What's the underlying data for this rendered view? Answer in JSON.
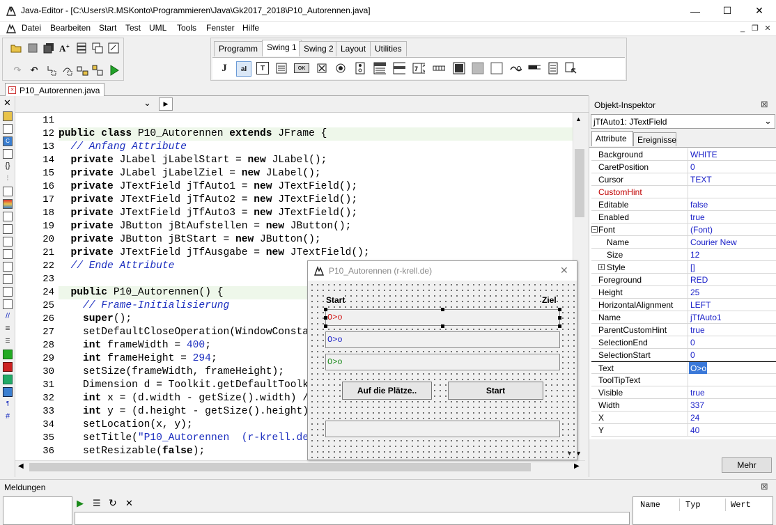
{
  "window": {
    "title": "Java-Editor - [C:\\Users\\R.MSKonto\\Programmieren\\Java\\Gk2017_2018\\P10_Autorennen.java]",
    "minimize_glyph": "—",
    "maximize_glyph": "☐",
    "close_glyph": "✕"
  },
  "menu": {
    "items": [
      "Datei",
      "Bearbeiten",
      "Start",
      "Test",
      "UML",
      "Tools",
      "Fenster",
      "Hilfe"
    ],
    "mdi_min": "_",
    "mdi_restore": "❐",
    "mdi_close": "✕"
  },
  "palette_tabs": [
    "Programm",
    "Swing 1",
    "Swing 2",
    "Layout",
    "Utilities"
  ],
  "palette_active": "Swing 1",
  "swing_icons": {
    "j": "J",
    "label_a": "aI",
    "label_t": "T",
    "ok": "OK"
  },
  "editor": {
    "tab_label": "P10_Autorennen.java",
    "close_glyph": "✕",
    "dropdown_glyph": "⌄",
    "play_glyph": "▶",
    "lines": [
      {
        "n": "11",
        "segs": []
      },
      {
        "n": "12",
        "segs": [
          [
            "kw",
            "public class "
          ],
          [
            "n",
            "P10_Autorennen "
          ],
          [
            "kw",
            "extends "
          ],
          [
            "n",
            "JFrame {"
          ]
        ]
      },
      {
        "n": "13",
        "segs": [
          [
            "n",
            "  "
          ],
          [
            "cm",
            "// Anfang Attribute"
          ]
        ]
      },
      {
        "n": "14",
        "segs": [
          [
            "n",
            "  "
          ],
          [
            "kw",
            "private "
          ],
          [
            "n",
            "JLabel jLabelStart = "
          ],
          [
            "kw",
            "new "
          ],
          [
            "n",
            "JLabel();"
          ]
        ]
      },
      {
        "n": "15",
        "segs": [
          [
            "n",
            "  "
          ],
          [
            "kw",
            "private "
          ],
          [
            "n",
            "JLabel jLabelZiel = "
          ],
          [
            "kw",
            "new "
          ],
          [
            "n",
            "JLabel();"
          ]
        ]
      },
      {
        "n": "16",
        "segs": [
          [
            "n",
            "  "
          ],
          [
            "kw",
            "private "
          ],
          [
            "n",
            "JTextField jTfAuto1 = "
          ],
          [
            "kw",
            "new "
          ],
          [
            "n",
            "JTextField();"
          ]
        ]
      },
      {
        "n": "17",
        "segs": [
          [
            "n",
            "  "
          ],
          [
            "kw",
            "private "
          ],
          [
            "n",
            "JTextField jTfAuto2 = "
          ],
          [
            "kw",
            "new "
          ],
          [
            "n",
            "JTextField();"
          ]
        ]
      },
      {
        "n": "18",
        "segs": [
          [
            "n",
            "  "
          ],
          [
            "kw",
            "private "
          ],
          [
            "n",
            "JTextField jTfAuto3 = "
          ],
          [
            "kw",
            "new "
          ],
          [
            "n",
            "JTextField();"
          ]
        ]
      },
      {
        "n": "19",
        "segs": [
          [
            "n",
            "  "
          ],
          [
            "kw",
            "private "
          ],
          [
            "n",
            "JButton jBtAufstellen = "
          ],
          [
            "kw",
            "new "
          ],
          [
            "n",
            "JButton();"
          ]
        ]
      },
      {
        "n": "20",
        "segs": [
          [
            "n",
            "  "
          ],
          [
            "kw",
            "private "
          ],
          [
            "n",
            "JButton jBtStart = "
          ],
          [
            "kw",
            "new "
          ],
          [
            "n",
            "JButton();"
          ]
        ]
      },
      {
        "n": "21",
        "segs": [
          [
            "n",
            "  "
          ],
          [
            "kw",
            "private "
          ],
          [
            "n",
            "JTextField jTfAusgabe = "
          ],
          [
            "kw",
            "new "
          ],
          [
            "n",
            "JTextField();"
          ]
        ]
      },
      {
        "n": "22",
        "segs": [
          [
            "n",
            "  "
          ],
          [
            "cm",
            "// Ende Attribute"
          ]
        ]
      },
      {
        "n": "23",
        "segs": []
      },
      {
        "n": "24",
        "segs": [
          [
            "n",
            "  "
          ],
          [
            "kw",
            "public "
          ],
          [
            "n",
            "P10_Autorennen() {"
          ]
        ]
      },
      {
        "n": "25",
        "segs": [
          [
            "n",
            "    "
          ],
          [
            "cm",
            "// Frame-Initialisierung"
          ]
        ]
      },
      {
        "n": "26",
        "segs": [
          [
            "n",
            "    "
          ],
          [
            "kw",
            "super"
          ],
          [
            "n",
            "();"
          ]
        ]
      },
      {
        "n": "27",
        "segs": [
          [
            "n",
            "    setDefaultCloseOperation(WindowConstants.DISPOSE_ON_CLOSE);"
          ]
        ]
      },
      {
        "n": "28",
        "segs": [
          [
            "n",
            "    "
          ],
          [
            "kw",
            "int "
          ],
          [
            "n",
            "frameWidth = "
          ],
          [
            "num",
            "400"
          ],
          [
            "n",
            ";"
          ]
        ]
      },
      {
        "n": "29",
        "segs": [
          [
            "n",
            "    "
          ],
          [
            "kw",
            "int "
          ],
          [
            "n",
            "frameHeight = "
          ],
          [
            "num",
            "294"
          ],
          [
            "n",
            ";"
          ]
        ]
      },
      {
        "n": "30",
        "segs": [
          [
            "n",
            "    setSize(frameWidth, frameHeight);"
          ]
        ]
      },
      {
        "n": "31",
        "segs": [
          [
            "n",
            "    Dimension d = Toolkit.getDefaultToolkit().getScreenSize();"
          ]
        ]
      },
      {
        "n": "32",
        "segs": [
          [
            "n",
            "    "
          ],
          [
            "kw",
            "int "
          ],
          [
            "n",
            "x = (d.width - getSize().width) / 2;"
          ]
        ]
      },
      {
        "n": "33",
        "segs": [
          [
            "n",
            "    "
          ],
          [
            "kw",
            "int "
          ],
          [
            "n",
            "y = (d.height - getSize().height) / 2;"
          ]
        ]
      },
      {
        "n": "34",
        "segs": [
          [
            "n",
            "    setLocation(x, y);"
          ]
        ]
      },
      {
        "n": "35",
        "segs": [
          [
            "n",
            "    setTitle("
          ],
          [
            "str",
            "\"P10_Autorennen  (r-krell.de)\""
          ],
          [
            "n",
            ");"
          ]
        ]
      },
      {
        "n": "36",
        "segs": [
          [
            "n",
            "    setResizable("
          ],
          [
            "kw",
            "false"
          ],
          [
            "n",
            ");"
          ]
        ]
      }
    ]
  },
  "designer": {
    "title": "P10_Autorennen  (r-krell.de)",
    "close_glyph": "✕",
    "label_start": "Start",
    "label_ziel": "Ziel",
    "auto1": "O>o",
    "auto2": "O>o",
    "auto3": "O>o",
    "auto1_color": "#d01010",
    "auto2_color": "#1a20c8",
    "auto3_color": "#1a8a1a",
    "btn_aufstellen": "Auf die Plätze..",
    "btn_start": "Start",
    "ausgabe": ""
  },
  "inspector": {
    "title": "Objekt-Inspektor",
    "close_glyph": "⊠",
    "selected": "jTfAuto1: JTextField",
    "tab_attribute": "Attribute",
    "tab_ereignisse": "Ereignisse",
    "more_button": "Mehr",
    "properties": [
      {
        "name": "Background",
        "value": "WHITE"
      },
      {
        "name": "CaretPosition",
        "value": "0"
      },
      {
        "name": "Cursor",
        "value": "TEXT"
      },
      {
        "name": "CustomHint",
        "value": ""
      },
      {
        "name": "Editable",
        "value": "false"
      },
      {
        "name": "Enabled",
        "value": "true"
      },
      {
        "name": "Font",
        "value": "(Font)"
      },
      {
        "name": "Name",
        "value": "Courier New"
      },
      {
        "name": "Size",
        "value": "12"
      },
      {
        "name": "Style",
        "value": "[]"
      },
      {
        "name": "Foreground",
        "value": "RED"
      },
      {
        "name": "Height",
        "value": "25"
      },
      {
        "name": "HorizontalAlignment",
        "value": "LEFT"
      },
      {
        "name": "Name",
        "value": "jTfAuto1"
      },
      {
        "name": "ParentCustomHint",
        "value": "true"
      },
      {
        "name": "SelectionEnd",
        "value": "0"
      },
      {
        "name": "SelectionStart",
        "value": "0"
      },
      {
        "name": "Text",
        "value": "O>o"
      },
      {
        "name": "ToolTipText",
        "value": ""
      },
      {
        "name": "Visible",
        "value": "true"
      },
      {
        "name": "Width",
        "value": "337"
      },
      {
        "name": "X",
        "value": "24"
      },
      {
        "name": "Y",
        "value": "40"
      }
    ]
  },
  "messages": {
    "title": "Meldungen",
    "close_glyph": "⊠",
    "col_name": "Name",
    "col_typ": "Typ",
    "col_wert": "Wert",
    "play_glyph": "▶",
    "list_glyph": "☰",
    "refresh_glyph": "↻",
    "x_glyph": "✕"
  },
  "colors": {
    "keyword": "#000000",
    "comment": "#1c2fbf",
    "property_value": "#1a20c8",
    "custom_hint_name": "#c00000",
    "line_highlight": "#eef7ea"
  }
}
